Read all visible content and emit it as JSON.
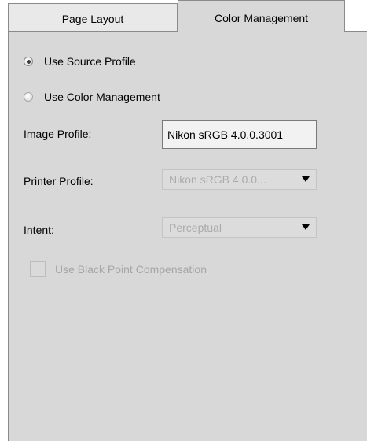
{
  "tabs": {
    "page_layout": "Page Layout",
    "color_management": "Color Management",
    "active": "Color Management"
  },
  "color_management": {
    "options": {
      "use_source_profile": "Use Source Profile",
      "use_color_management": "Use Color Management",
      "selected": "Use Source Profile"
    },
    "image_profile": {
      "label": "Image Profile:",
      "value": "Nikon sRGB 4.0.0.3001"
    },
    "printer_profile": {
      "label": "Printer Profile:",
      "value": "Nikon sRGB 4.0.0...",
      "enabled": false
    },
    "intent": {
      "label": "Intent:",
      "value": "Perceptual",
      "enabled": false
    },
    "black_point_compensation": {
      "label": "Use Black Point Compensation",
      "checked": false,
      "enabled": false
    }
  },
  "colors": {
    "panel_background": "#d8d8d8",
    "disabled_text": "#a6a6a6",
    "tab_border": "#8a8a8a"
  }
}
